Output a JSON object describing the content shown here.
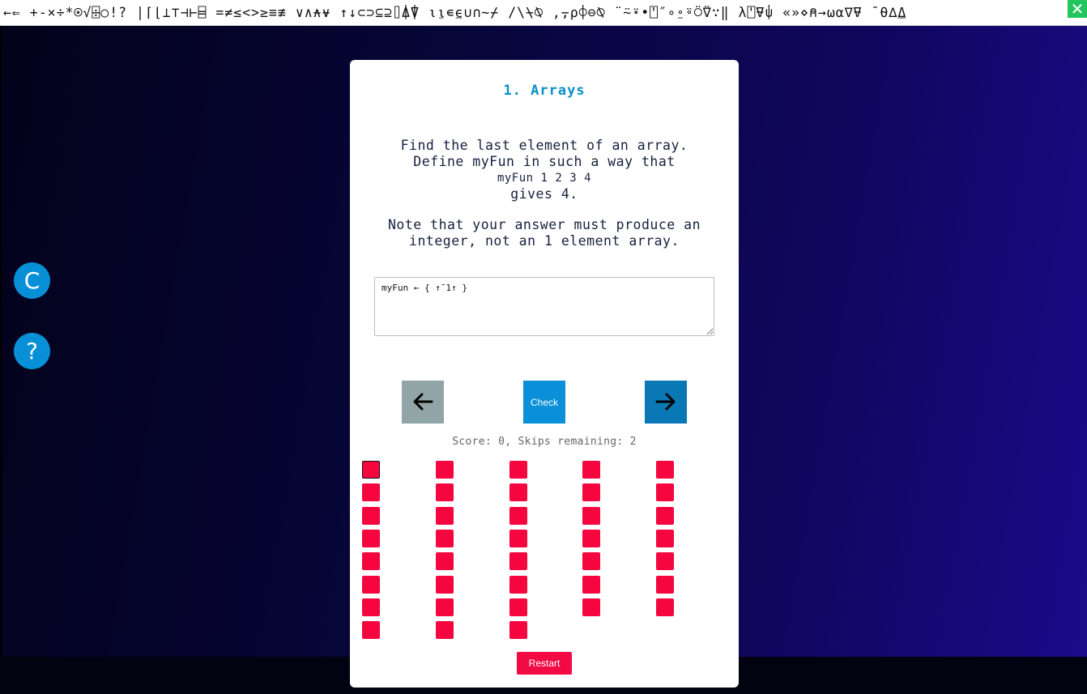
{
  "toolbar": {
    "glyphs": "←⇐ +-×÷*⍟√⌹○!? |⌈⌊⊥⊤⊣⊢⌸ =≠≤<>≥≡≢ ∨∧⍲⍱ ↑↓⊂⊃⊆⊇⌷⍋⍒ ⍳⍸∊⍷∪∩~⌿ /\\⍀⍉ ,⍪⍴⌽⊖⍉ ¨⍨⍣•⍞″∘⍛⍤⍥⍢∵‖ λ⍞⍫⍦ «»⋄⍝→⍵⍺∇⍫ ¯⍬∆⍙",
    "close_icon": "✕"
  },
  "side": {
    "c_label": "C",
    "help_label": "?"
  },
  "card": {
    "title": "1. Arrays",
    "prompt_line1": "Find the last element of an array.",
    "prompt_line2": "Define myFun in such a way that",
    "prompt_code": "myFun 1 2 3 4",
    "prompt_line3": "gives 4.",
    "note_line1": "Note that your answer must produce an",
    "note_line2": "integer, not an 1 element array.",
    "answer_value": "myFun ← { ↑¯1↑ }",
    "check_label": "Check",
    "score_text": "Score: 0, Skips remaining: 2",
    "restart_label": "Restart"
  },
  "progress": {
    "columns": [
      8,
      8,
      8,
      7,
      7
    ],
    "current": [
      0,
      0
    ],
    "color": "#f5063f"
  }
}
